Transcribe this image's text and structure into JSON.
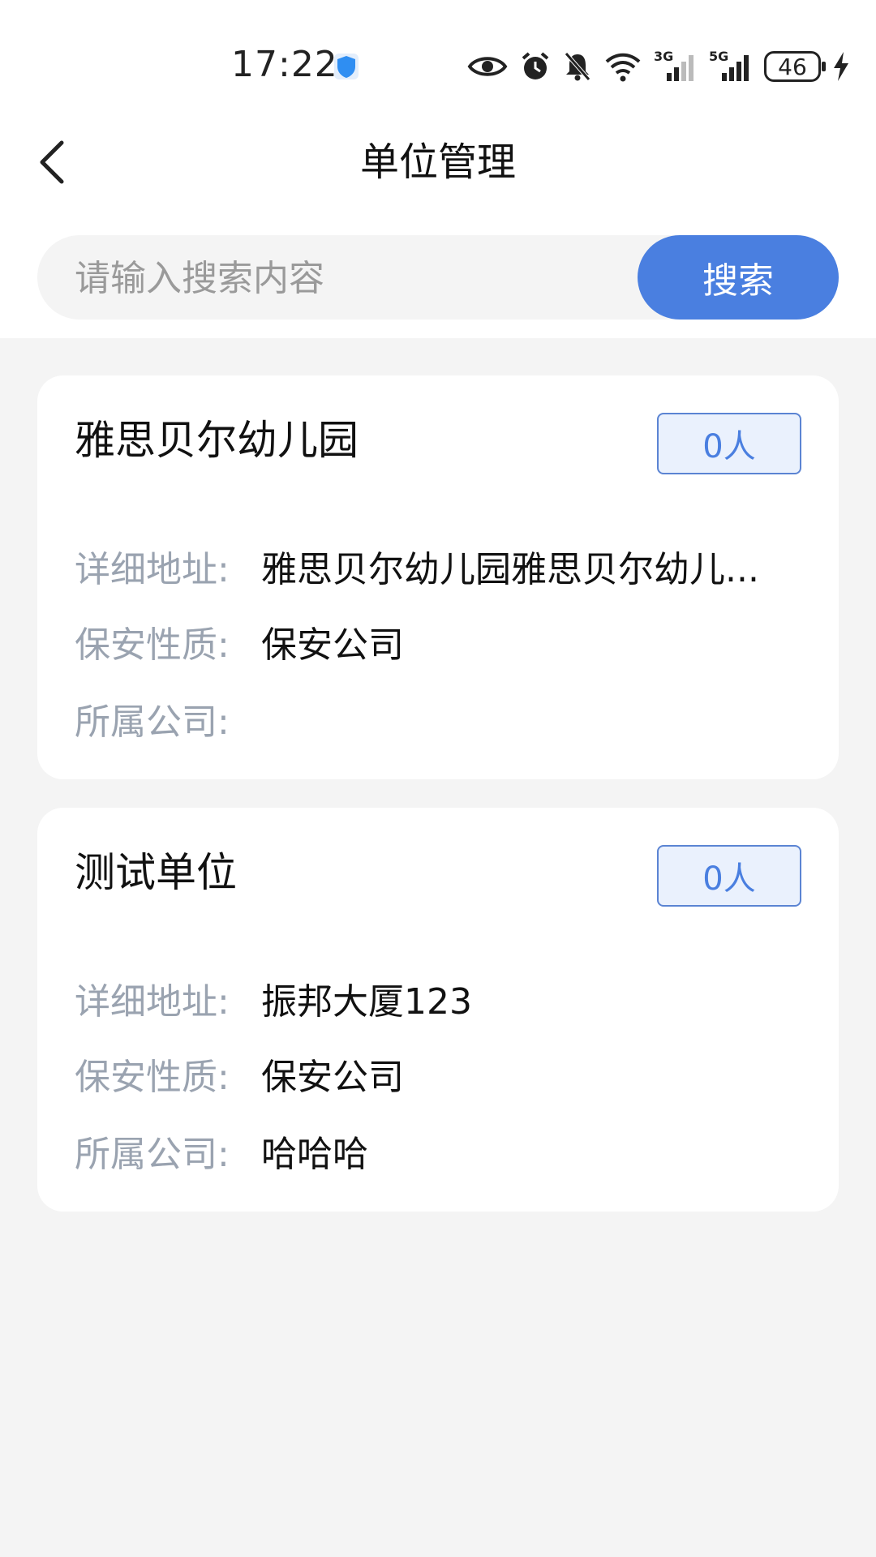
{
  "status_bar": {
    "time": "17:22",
    "signal_3g": "3G",
    "signal_5g": "5G",
    "battery": "46"
  },
  "header": {
    "title": "单位管理"
  },
  "search": {
    "placeholder": "请输入搜索内容",
    "button_label": "搜索"
  },
  "units": [
    {
      "name": "雅思贝尔幼儿园",
      "count": "0人",
      "address_label": "详细地址:",
      "address": "雅思贝尔幼儿园雅思贝尔幼儿...",
      "nature_label": "保安性质:",
      "nature": "保安公司",
      "company_label": "所属公司:",
      "company": ""
    },
    {
      "name": "测试单位",
      "count": "0人",
      "address_label": "详细地址:",
      "address": "振邦大厦123",
      "nature_label": "保安性质:",
      "nature": "保安公司",
      "company_label": "所属公司:",
      "company": "哈哈哈"
    }
  ],
  "colors": {
    "accent": "#4a7fe0",
    "label": "#9aa3b0",
    "background": "#f4f4f4"
  }
}
